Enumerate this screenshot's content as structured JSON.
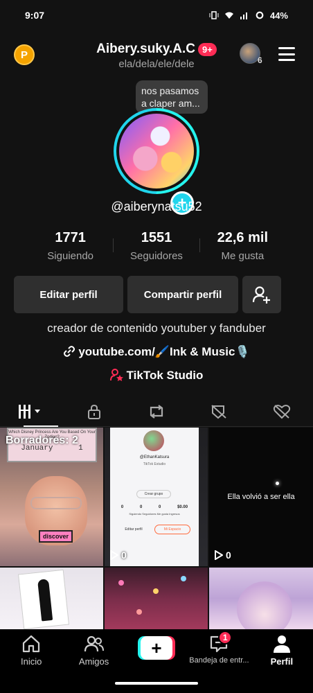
{
  "status_bar": {
    "time": "9:07",
    "battery": "44%"
  },
  "header": {
    "coin_letter": "P",
    "username": "Aibery.suky.A.C",
    "notif_badge": "9+",
    "pronouns": "ela/dela/ele/dele",
    "friends_count": "6"
  },
  "profile": {
    "note_text": "nos pasamos a claper am...",
    "handle": "@aiberynatsu52",
    "stats": [
      {
        "value": "1771",
        "label": "Siguiendo"
      },
      {
        "value": "1551",
        "label": "Seguidores"
      },
      {
        "value": "22,6 mil",
        "label": "Me gusta"
      }
    ],
    "buttons": {
      "edit": "Editar perfil",
      "share": "Compartir perfil"
    },
    "bio": "creador de contenido youtuber y fanduber",
    "link": "youtube.com/🖌️Ink & Music🎙️",
    "studio": "TikTok Studio"
  },
  "tabs": [
    "videos-grid-icon",
    "lock-icon",
    "repost-icon",
    "hidden-likes-icon",
    "heart-slash-icon"
  ],
  "grid": {
    "drafts_label": "Borradores: 2",
    "cell1": {
      "calendar_title": "Which Disney Princess Are You Based On Your Zodiac?",
      "month": "January",
      "day": "1",
      "sticker": "discover"
    },
    "cell2": {
      "name": "@EthanKatsura",
      "sub": "TikTok Estudio",
      "btn": "Crear grupo",
      "stats": [
        "0",
        "0",
        "0",
        "$0.00"
      ],
      "labels": "Siguiendo  Seguidores  Me gusta  Ingresos",
      "edit": "Editar perfil",
      "space": "Mi Espacio",
      "views": "0"
    },
    "cell3": {
      "caption": "Ella volvió a ser ella",
      "views": "0"
    }
  },
  "nav": {
    "home": "Inicio",
    "friends": "Amigos",
    "inbox": "Bandeja de entr...",
    "inbox_badge": "1",
    "profile": "Perfil"
  },
  "colors": {
    "accent_cyan": "#25f4ee",
    "accent_red": "#fe2c55",
    "coin": "#f5a300"
  }
}
